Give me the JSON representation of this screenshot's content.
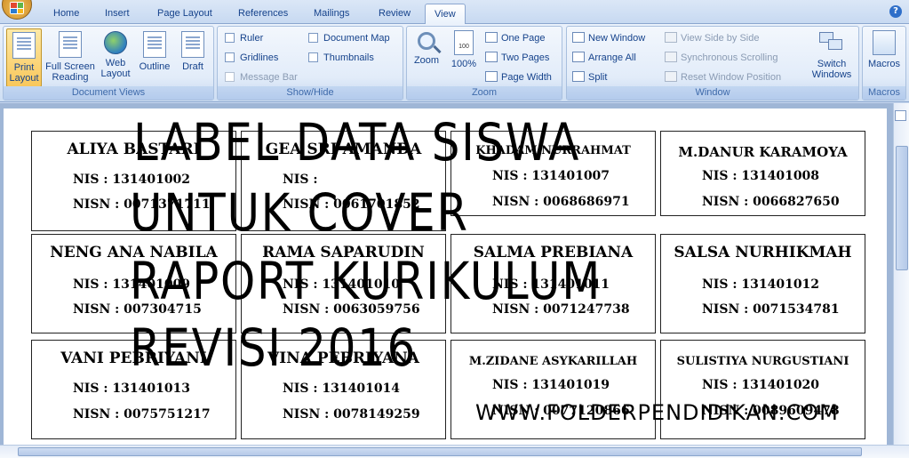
{
  "tabs": [
    "Home",
    "Insert",
    "Page Layout",
    "References",
    "Mailings",
    "Review",
    "View"
  ],
  "active_tab": "View",
  "ribbon": {
    "document_views": {
      "label": "Document Views",
      "buttons": [
        "Print Layout",
        "Full Screen Reading",
        "Web Layout",
        "Outline",
        "Draft"
      ]
    },
    "show_hide": {
      "label": "Show/Hide",
      "ruler": "Ruler",
      "gridlines": "Gridlines",
      "message_bar": "Message Bar",
      "document_map": "Document Map",
      "thumbnails": "Thumbnails"
    },
    "zoom": {
      "label": "Zoom",
      "zoom": "Zoom",
      "hundred": "100%",
      "one_page": "One Page",
      "two_pages": "Two Pages",
      "page_width": "Page Width"
    },
    "window": {
      "label": "Window",
      "new_window": "New Window",
      "arrange_all": "Arrange All",
      "split": "Split",
      "view_side_by_side": "View Side by Side",
      "sync_scrolling": "Synchronous Scrolling",
      "reset_window": "Reset Window Position",
      "switch_windows": "Switch Windows"
    },
    "macros": {
      "label": "Macros",
      "button": "Macros"
    }
  },
  "labels": [
    {
      "name": "ALIYA BASTARI",
      "nis": "NIS    : 131401002",
      "nisn": "NISN : 0071371711"
    },
    {
      "name": "GEA SRI AMANDA",
      "nis": "NIS    :",
      "nisn": "NISN : 0061701852"
    },
    {
      "name": "KHADAM NURRAHMAT",
      "nis": "NIS    : 131401007",
      "nisn": "NISN : 0068686971"
    },
    {
      "name": "M.DANUR KARAMOYA",
      "nis": "NIS    : 131401008",
      "nisn": "NISN : 0066827650"
    },
    {
      "name": "NENG ANA NABILA",
      "nis": "NIS    : 131401009",
      "nisn": "NISN : 007304715"
    },
    {
      "name": "RAMA SAPARUDIN",
      "nis": "NIS    : 131401010",
      "nisn": "NISN : 0063059756"
    },
    {
      "name": "SALMA PREBIANA",
      "nis": "NIS    : 131401011",
      "nisn": "NISN : 0071247738"
    },
    {
      "name": "SALSA NURHIKMAH",
      "nis": "NIS    : 131401012",
      "nisn": "NISN : 0071534781"
    },
    {
      "name": "VANI PEBRIYANI",
      "nis": "NIS    : 131401013",
      "nisn": "NISN : 0075751217"
    },
    {
      "name": "VINA PEBRIYANA",
      "nis": "NIS    : 131401014",
      "nisn": "NISN : 0078149259"
    },
    {
      "name": "M.ZIDANE ASYKARILLAH",
      "nis": "NIS    : 131401019",
      "nisn": "NISN : 0077120866"
    },
    {
      "name": "SULISTIYA NURGUSTIANI",
      "nis": "NIS    : 131401020",
      "nisn": "NISN : 0089609478"
    }
  ],
  "overlay": {
    "line1": "LABEL DATA SISWA",
    "line2": "UNTUK COVER",
    "line3": "RAPORT KURIKULUM",
    "line4": "REVISI 2016",
    "watermark": "WWW.FOLDERPENDIDIKAN.COM"
  },
  "icons": [
    "office-button-icon",
    "help-icon",
    "print-layout-icon",
    "full-screen-reading-icon",
    "web-layout-icon",
    "outline-icon",
    "draft-icon",
    "zoom-icon",
    "hundred-percent-icon",
    "switch-windows-icon",
    "macros-icon"
  ],
  "colors": {
    "ribbon_text": "#15428b",
    "active_button": "#f9c75b",
    "page": "#ffffff"
  }
}
